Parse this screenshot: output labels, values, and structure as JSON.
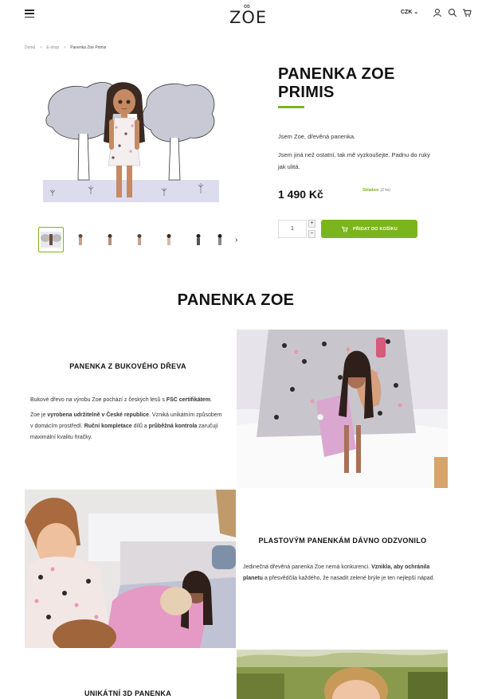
{
  "header": {
    "logo": "ZOE",
    "currency": "CZK",
    "icons": [
      "menu-icon",
      "user-icon",
      "search-icon",
      "cart-icon"
    ]
  },
  "breadcrumb": [
    "Domů",
    "E-shop",
    "Panenka Zoe Primis"
  ],
  "product": {
    "title": "PANENKA ZOE PRIMIS",
    "description": [
      "Jsem Zoe, dřevěná panenka.",
      "Jsem jiná než ostatní, tak mě vyzkoušejte. Padnu do ruky jak ulitá."
    ],
    "price": "1 490 Kč",
    "stock_label": "Skladem",
    "stock_qty": "(2 ks)",
    "quantity": "1",
    "qty_plus": "+",
    "qty_minus": "−",
    "add_to_cart": "PŘIDAT DO KOŠÍKU",
    "accent_color": "#7ab51d"
  },
  "section": {
    "title": "PANENKA ZOE",
    "block1": {
      "heading": "PANENKA Z BUKOVÉHO DŘEVA",
      "p1_a": "Bukové dřevo na výrobu Zoe pochází z českých lesů s ",
      "p1_b": "FSC certifikátem",
      "p1_c": ".",
      "p2_a": "Zoe je ",
      "p2_b": "vyrobena udržitelně v České republice",
      "p2_c": ". Vzniká unikátním způsobem v domácím prostředí. ",
      "p2_d": "Ruční kompletace",
      "p2_e": " dílů a ",
      "p2_f": "průběžná kontrola",
      "p2_g": " zaručují maximální kvalitu hračky."
    },
    "block2": {
      "heading": "PLASTOVÝM PANENKÁM DÁVNO ODZVONILO",
      "p1_a": "Jedinečná dřevěná panenka Zoe nemá konkurenci. ",
      "p1_b": "Vznikla, aby ochránila planetu",
      "p1_c": " a přesvědčila každého, že nasadit zelené brýle je ten nejlepší nápad."
    },
    "block3": {
      "heading": "UNIKÁTNÍ 3D PANENKA"
    }
  }
}
